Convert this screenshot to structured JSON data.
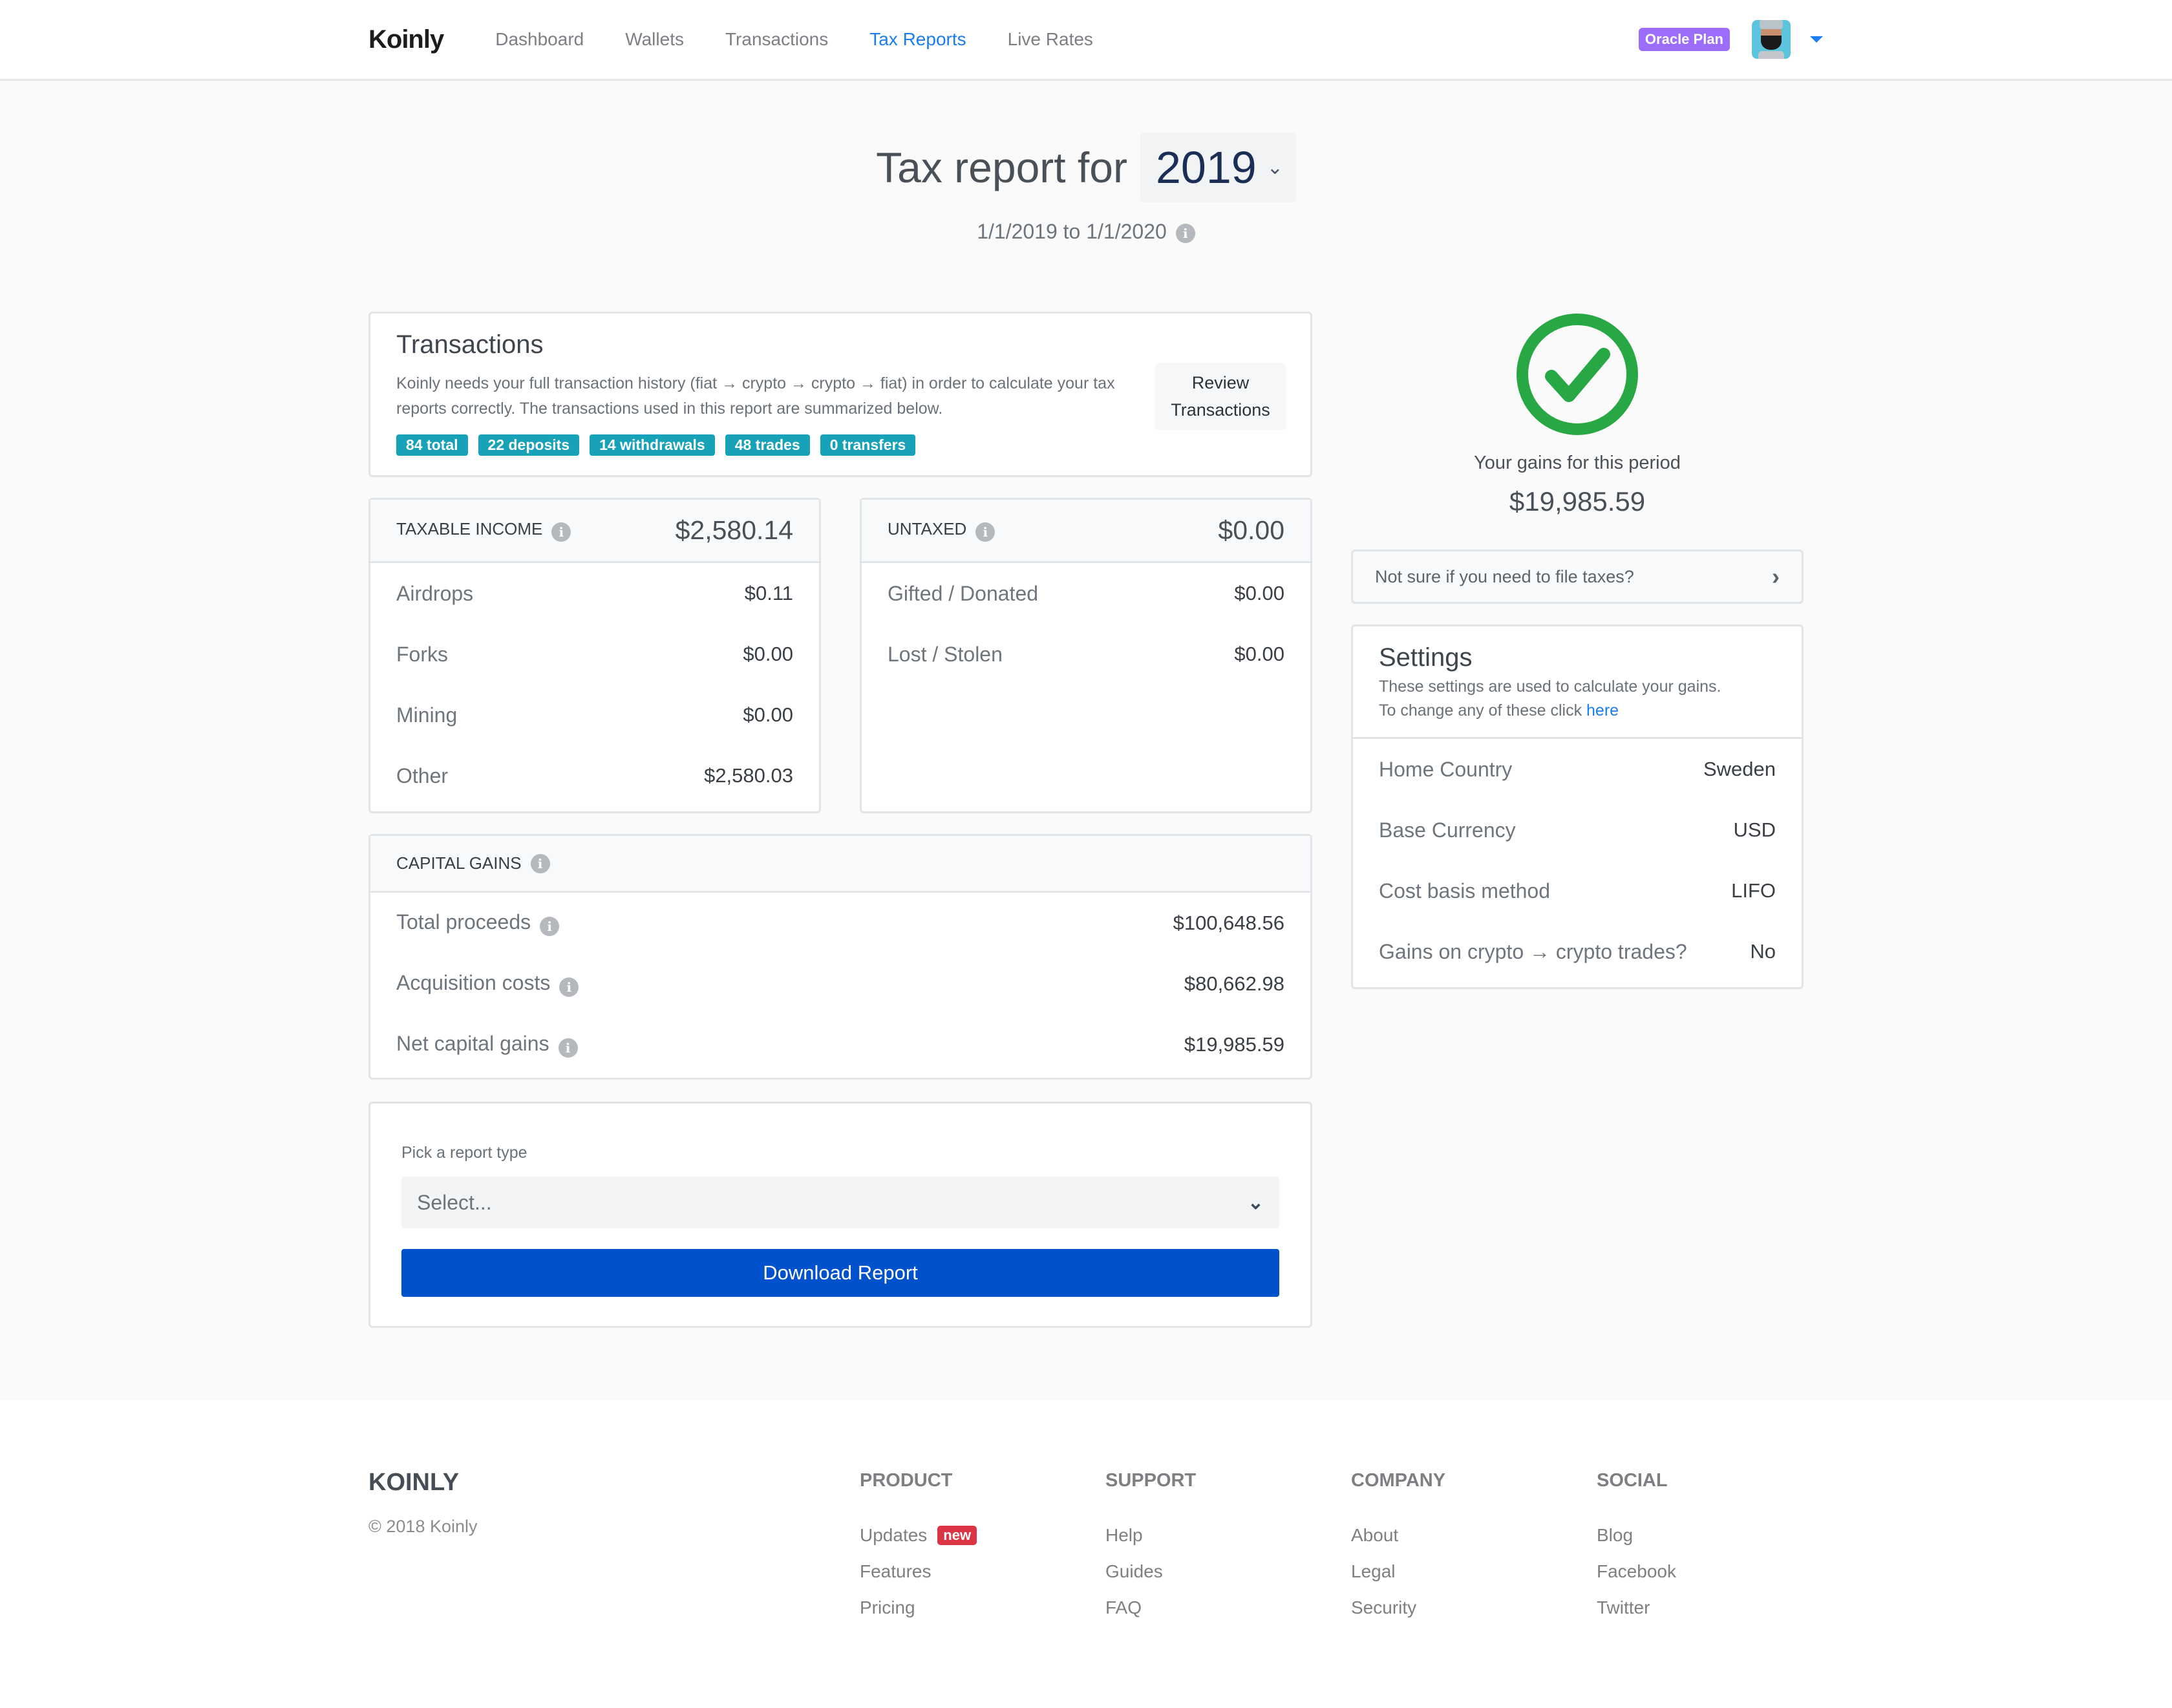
{
  "nav": {
    "logo": "Koinly",
    "items": [
      {
        "label": "Dashboard",
        "active": false
      },
      {
        "label": "Wallets",
        "active": false
      },
      {
        "label": "Transactions",
        "active": false
      },
      {
        "label": "Tax Reports",
        "active": true
      },
      {
        "label": "Live Rates",
        "active": false
      }
    ],
    "plan_badge": "Oracle Plan",
    "accent_color": "#1a7ef0"
  },
  "header": {
    "title": "Tax report for",
    "year": "2019",
    "date_range": "1/1/2019 to 1/1/2020"
  },
  "transactions": {
    "title": "Transactions",
    "description": "Koinly needs your full transaction history (fiat → crypto → crypto → fiat) in order to calculate your tax reports correctly. The transactions used in this report are summarized below.",
    "review_button": "Review Transactions",
    "badges": [
      "84 total",
      "22 deposits",
      "14 withdrawals",
      "48 trades",
      "0 transfers"
    ]
  },
  "taxable_income": {
    "label": "TAXABLE INCOME",
    "total": "$2,580.14",
    "rows": [
      {
        "label": "Airdrops",
        "value": "$0.11"
      },
      {
        "label": "Forks",
        "value": "$0.00"
      },
      {
        "label": "Mining",
        "value": "$0.00"
      },
      {
        "label": "Other",
        "value": "$2,580.03"
      }
    ]
  },
  "untaxed": {
    "label": "UNTAXED",
    "total": "$0.00",
    "rows": [
      {
        "label": "Gifted / Donated",
        "value": "$0.00"
      },
      {
        "label": "Lost / Stolen",
        "value": "$0.00"
      }
    ]
  },
  "capital_gains": {
    "label": "CAPITAL GAINS",
    "rows": [
      {
        "label": "Total proceeds",
        "value": "$100,648.56"
      },
      {
        "label": "Acquisition costs",
        "value": "$80,662.98"
      },
      {
        "label": "Net capital gains",
        "value": "$19,985.59"
      }
    ]
  },
  "report": {
    "label": "Pick a report type",
    "select_placeholder": "Select...",
    "download_button": "Download Report"
  },
  "summary": {
    "status_icon": "check-circle-icon",
    "status_color": "#28a745",
    "gains_label": "Your gains for this period",
    "gains_value": "$19,985.59",
    "file_taxes_prompt": "Not sure if you need to file taxes?"
  },
  "settings": {
    "title": "Settings",
    "description": "These settings are used to calculate your gains.",
    "change_prefix": "To change any of these click",
    "change_link": "here",
    "rows": [
      {
        "label": "Home Country",
        "value": "Sweden"
      },
      {
        "label": "Base Currency",
        "value": "USD"
      },
      {
        "label": "Cost basis method",
        "value": "LIFO"
      },
      {
        "label": "Gains on crypto → crypto trades?",
        "value": "No"
      }
    ]
  },
  "footer": {
    "logo": "KOINLY",
    "copyright": "© 2018 Koinly",
    "columns": [
      {
        "title": "PRODUCT",
        "links": [
          "Updates",
          "Features",
          "Pricing"
        ],
        "badge": "new"
      },
      {
        "title": "SUPPORT",
        "links": [
          "Help",
          "Guides",
          "FAQ"
        ]
      },
      {
        "title": "COMPANY",
        "links": [
          "About",
          "Legal",
          "Security"
        ]
      },
      {
        "title": "SOCIAL",
        "links": [
          "Blog",
          "Facebook",
          "Twitter"
        ]
      }
    ]
  }
}
